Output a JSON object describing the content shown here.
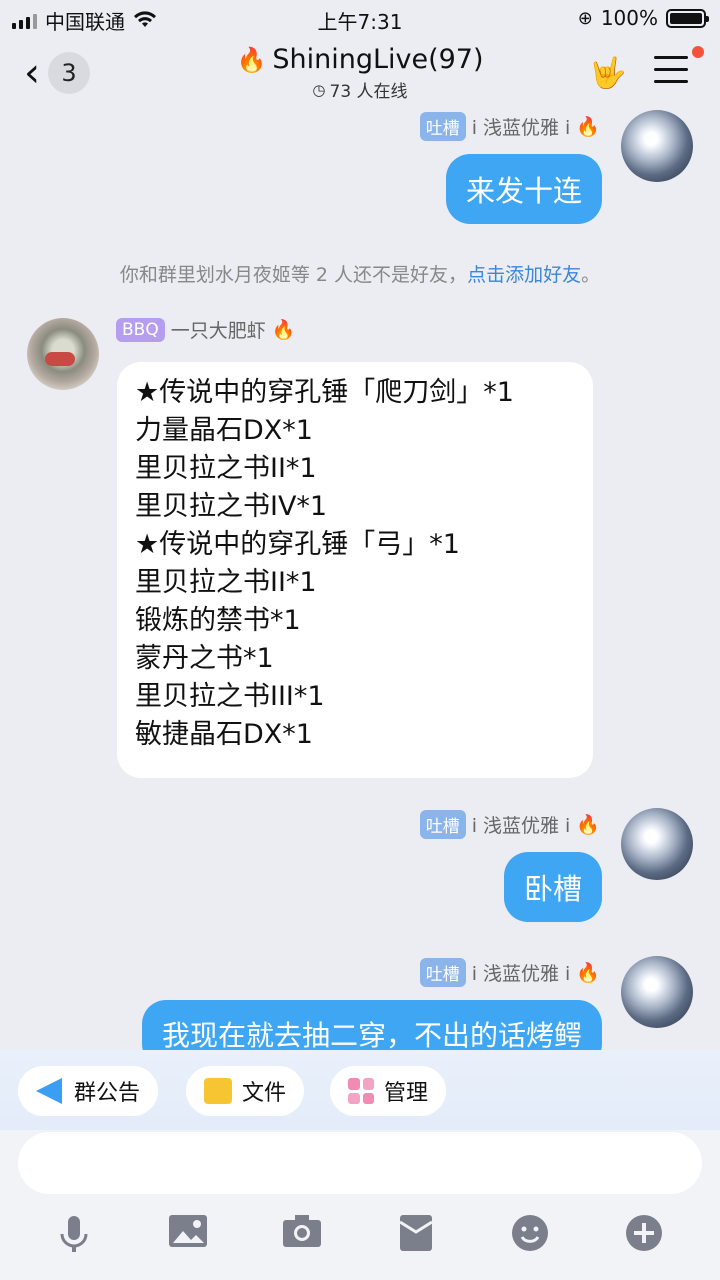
{
  "status": {
    "carrier": "中国联通",
    "time": "上午7:31",
    "battery": "100%"
  },
  "header": {
    "back_count": "3",
    "title": "ShiningLive(97)",
    "online": "73 人在线"
  },
  "messages": [
    {
      "sender_tag": "吐槽",
      "sender": "i 浅蓝优雅 i",
      "text": "来发十连"
    },
    {
      "sender_tag": "吐槽",
      "sender": "i 浅蓝优雅 i",
      "text": "卧槽"
    },
    {
      "sender_tag": "吐槽",
      "sender": "i 浅蓝优雅 i",
      "text": "我现在就去抽二穿，不出的话烤鳄"
    }
  ],
  "system_notice": {
    "text": "你和群里划水月夜姬等 2 人还不是好友，",
    "link": "点击添加好友",
    "end": "。"
  },
  "left_message": {
    "sender_tag": "BBQ",
    "sender": "一只大肥虾",
    "lines": [
      "★传说中的穿孔锤「爬刀剑」*1",
      "力量晶石DX*1",
      "里贝拉之书II*1",
      "里贝拉之书IV*1",
      "★传说中的穿孔锤「弓」*1",
      "里贝拉之书II*1",
      "锻炼的禁书*1",
      "蒙丹之书*1",
      "里贝拉之书III*1",
      "敏捷晶石DX*1"
    ]
  },
  "shortcuts": [
    {
      "label": "群公告"
    },
    {
      "label": "文件"
    },
    {
      "label": "管理"
    }
  ],
  "input": {
    "placeholder": ""
  },
  "colors": {
    "bubble_blue": "#3ea6f3",
    "link": "#3b86d6",
    "notify_dot": "#f4523b"
  }
}
